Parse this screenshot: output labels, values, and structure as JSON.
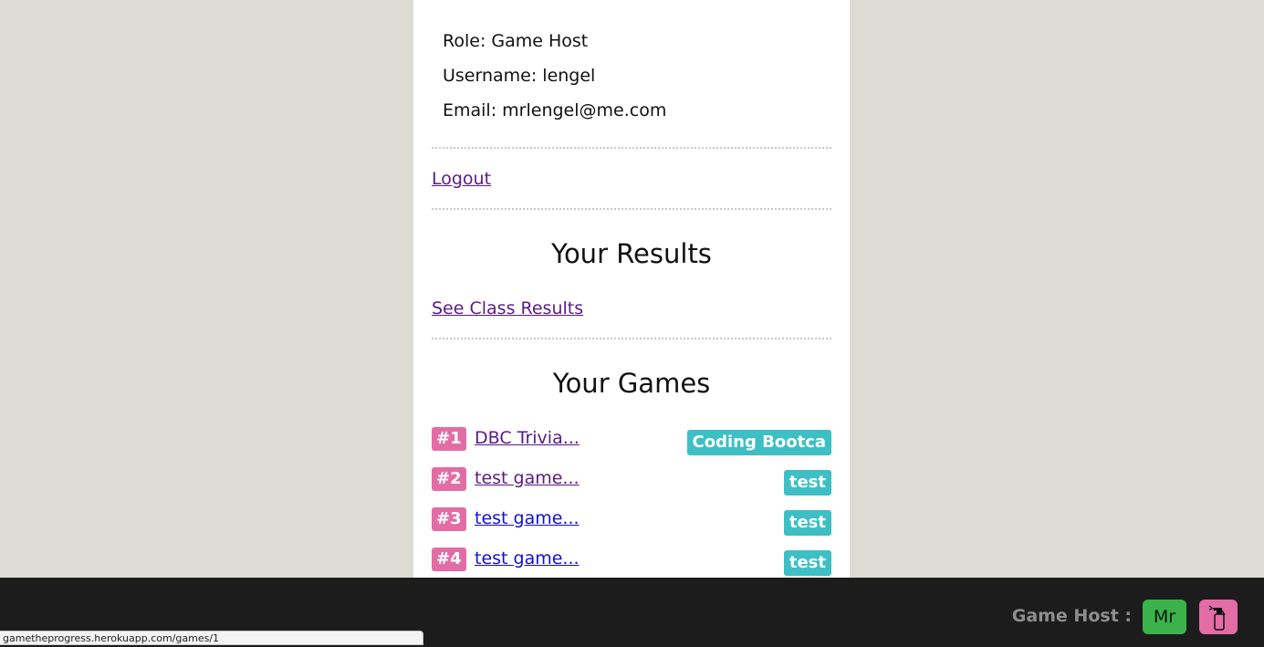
{
  "profile": {
    "role": "Role: Game Host",
    "username": "Username: lengel",
    "email": "Email: mrlengel@me.com"
  },
  "links": {
    "logout": "Logout",
    "class_results": "See Class Results"
  },
  "results_section": {
    "title": "Your Results"
  },
  "games_section": {
    "title": "Your Games",
    "games": [
      {
        "number": "#1",
        "name": "DBC Trivia...",
        "tag": "Coding Bootca",
        "visited": true
      },
      {
        "number": "#2",
        "name": "test game...",
        "tag": "test",
        "visited": true
      },
      {
        "number": "#3",
        "name": "test game...",
        "tag": "test",
        "visited": false
      },
      {
        "number": "#4",
        "name": "test game...",
        "tag": "test",
        "visited": false
      }
    ]
  },
  "footer": {
    "role_label": "Game Host :",
    "avatar_initials": "Mr",
    "avatar_icon": "spray-bottle-icon"
  },
  "status_bar": {
    "url": "gametheprogress.herokuapp.com/games/1"
  },
  "colors": {
    "background": "#dcdcd4",
    "number_badge": "#e26da5",
    "tag_badge": "#3dbfc4",
    "avatar_green": "#3bb34a",
    "footer_bg": "#1c1c1c",
    "visited_link": "#5b1a86",
    "unvisited_link": "#1010d8"
  }
}
